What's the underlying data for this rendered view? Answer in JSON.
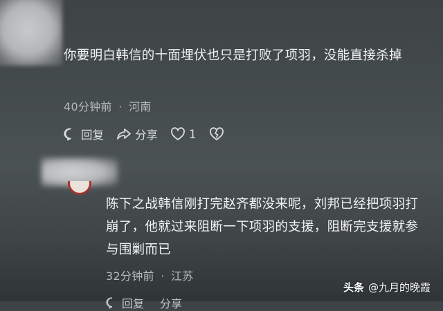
{
  "comments": [
    {
      "text": "你要明白韩信的十面埋伏也只是打败了项羽，没能直接杀掉",
      "time": "40分钟前",
      "separator": "·",
      "location": "河南",
      "actions": {
        "reply": "回复",
        "share": "分享",
        "like_count": "1"
      }
    },
    {
      "text": "陈下之战韩信刚打完赵齐都没来呢，刘邦已经把项羽打崩了，他就过来阻断一下项羽的支援，阻断完支援就参与围剿而已",
      "time": "32分钟前",
      "separator": "·",
      "location": "江苏",
      "actions": {
        "reply": "回复",
        "share": "分享"
      }
    }
  ],
  "watermark": {
    "brand": "头条",
    "handle": "@九月的晚霞"
  },
  "icons": [
    "reply-icon",
    "share-icon",
    "like-icon",
    "dislike-icon"
  ]
}
